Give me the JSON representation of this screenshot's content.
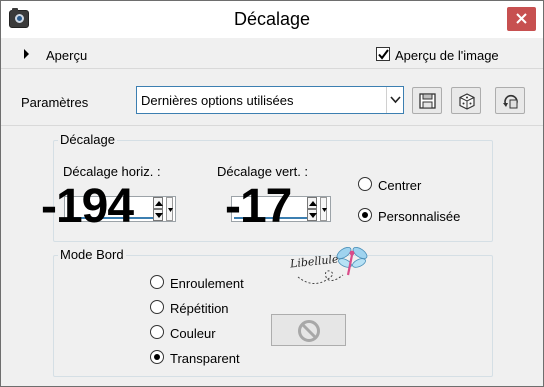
{
  "window": {
    "title": "Décalage",
    "close_icon": "close-icon"
  },
  "preview": {
    "label": "Aperçu",
    "image_preview_label": "Aperçu de l'image",
    "image_preview_checked": true
  },
  "params": {
    "label": "Paramètres",
    "preset_value": "Dernières options utilisées",
    "icons": [
      "save-icon",
      "dice-icon",
      "reset-icon"
    ]
  },
  "offset": {
    "group_title": "Décalage",
    "horiz_label": "Décalage horiz. :",
    "horiz_value": "-194",
    "vert_label": "Décalage vert. :",
    "vert_value": "-17",
    "center_label": "Centrer",
    "custom_label": "Personnalisée",
    "selected": "Personnalisée"
  },
  "edge_mode": {
    "group_title": "Mode Bord",
    "options": [
      "Enroulement",
      "Répétition",
      "Couleur",
      "Transparent"
    ],
    "selected": "Transparent"
  },
  "watermark": {
    "text": "Libellule"
  },
  "colors": {
    "close_red": "#c75050",
    "accent_blue": "#3c7fb1"
  }
}
